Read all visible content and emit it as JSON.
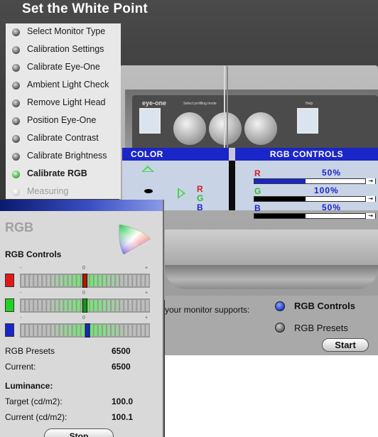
{
  "header": {
    "title": "Set the White Point"
  },
  "steps": [
    {
      "label": "Select Monitor Type",
      "state": "done"
    },
    {
      "label": "Calibration Settings",
      "state": "done"
    },
    {
      "label": "Calibrate Eye-One",
      "state": "done"
    },
    {
      "label": "Ambient Light Check",
      "state": "done"
    },
    {
      "label": "Remove Light Head",
      "state": "done"
    },
    {
      "label": "Position Eye-One",
      "state": "done"
    },
    {
      "label": "Calibrate Contrast",
      "state": "done"
    },
    {
      "label": "Calibrate Brightness",
      "state": "done"
    },
    {
      "label": "Calibrate RGB",
      "state": "active"
    },
    {
      "label": "Measuring",
      "state": "pending"
    }
  ],
  "monitor_screen": {
    "logo": "eye-one",
    "mode": "Select profiling mode",
    "help": "Help"
  },
  "color_panel": {
    "heading": "COLOR",
    "letters": [
      "R",
      "G",
      "B"
    ],
    "letter_colors": [
      "#d22020",
      "#2fbf2f",
      "#1a26c8"
    ]
  },
  "rgb_controls_panel": {
    "heading": "RGB CONTROLS",
    "channels": [
      {
        "letter": "R",
        "value_text": "50%",
        "level": 0.5,
        "color": "#d22020",
        "fill": "#1a26c8"
      },
      {
        "letter": "G",
        "value_text": "100%",
        "level": 0.5,
        "color": "#2fbf2f",
        "fill": "#000000"
      },
      {
        "letter": "B",
        "value_text": "50%",
        "level": 0.5,
        "color": "#1a26c8",
        "fill": "#000000"
      }
    ]
  },
  "selector": {
    "prompt": "your monitor supports:",
    "options": [
      {
        "label": "RGB Controls",
        "selected": true
      },
      {
        "label": "RGB Presets",
        "selected": false
      }
    ],
    "start_label": "Start"
  },
  "rgb_window": {
    "title": "RGB",
    "subtitle": "RGB Controls",
    "scale": {
      "minus": "-",
      "zero": "0",
      "plus": "+"
    },
    "channels": [
      {
        "name": "red",
        "swatch": "#e01818",
        "marker_color": "#c01010",
        "position": 0.5
      },
      {
        "name": "green",
        "swatch": "#22d122",
        "marker_color": "#1f8f1f",
        "position": 0.5
      },
      {
        "name": "blue",
        "swatch": "#1a26c8",
        "marker_color": "#1a26c8",
        "position": 0.52
      }
    ],
    "rows": [
      {
        "label": "RGB Presets",
        "value": "6500"
      },
      {
        "label": "Current:",
        "value": "6500"
      }
    ],
    "luminance": {
      "heading": "Luminance:",
      "target_label": "Target (cd/m2):",
      "target_value": "100.0",
      "current_label": "Current (cd/m2):",
      "current_value": "100.1"
    },
    "stop_label": "Stop"
  },
  "colors": {
    "panel_blue": "#1a26c8",
    "active_green": "#2fa02c"
  }
}
